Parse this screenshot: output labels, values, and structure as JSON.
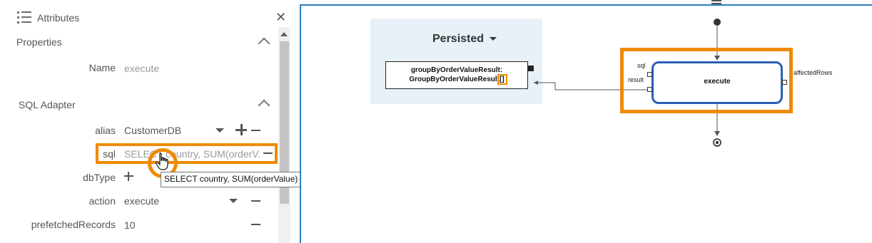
{
  "panel": {
    "title": "Attributes"
  },
  "properties": {
    "title": "Properties",
    "name_label": "Name",
    "name_value": "execute"
  },
  "sql_adapter": {
    "title": "SQL Adapter",
    "alias_label": "alias",
    "alias_value": "CustomerDB",
    "sql_label": "sql",
    "sql_value": "SELECT country, SUM(orderV...",
    "dbtype_label": "dbType",
    "action_label": "action",
    "action_value": "execute",
    "prefetched_label": "prefetchedRecords",
    "prefetched_value": "10"
  },
  "tooltip": {
    "text": "SELECT country, SUM(orderValue) AS orderValue FROM Customers GROUP BY country"
  },
  "diagram": {
    "persisted_title": "Persisted",
    "result_line1": "groupByOrderValueResult:",
    "result_line2": "GroupByOrderValueResult[]",
    "execute_label": "execute",
    "port_sql": "sql",
    "port_result": "result",
    "port_affected": "affectedRows"
  },
  "colors": {
    "highlight": "#f08a00",
    "node_border": "#2a5fb8",
    "persisted_bg": "#e8f1f8",
    "canvas_border": "#2a7fbf"
  },
  "icons": [
    "hamburger-icon",
    "close-icon",
    "chevron-up-icon",
    "caret-down-icon",
    "plus-icon",
    "minus-icon",
    "hand-cursor-icon",
    "menu-icon"
  ]
}
